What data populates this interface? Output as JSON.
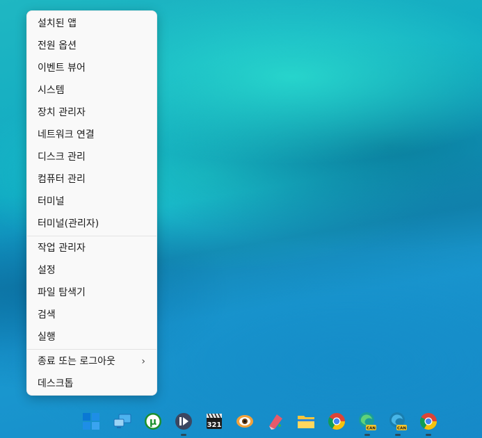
{
  "menu": {
    "items": [
      {
        "label": "설치된 앱"
      },
      {
        "label": "전원 옵션"
      },
      {
        "label": "이벤트 뷰어"
      },
      {
        "label": "시스템"
      },
      {
        "label": "장치 관리자"
      },
      {
        "label": "네트워크 연결"
      },
      {
        "label": "디스크 관리"
      },
      {
        "label": "컴퓨터 관리"
      },
      {
        "label": "터미널"
      },
      {
        "label": "터미널(관리자)"
      },
      {
        "label": "작업 관리자"
      },
      {
        "label": "설정"
      },
      {
        "label": "파일 탐색기"
      },
      {
        "label": "검색"
      },
      {
        "label": "실행"
      },
      {
        "label": "종료 또는 로그아웃",
        "chevron": "›"
      },
      {
        "label": "데스크톱"
      }
    ]
  },
  "taskbar": {
    "icons": [
      {
        "name": "windows-start-icon"
      },
      {
        "name": "remote-desktop-icon"
      },
      {
        "name": "utorrent-icon"
      },
      {
        "name": "media-player-icon"
      },
      {
        "name": "media-player-classic-icon"
      },
      {
        "name": "eye-app-icon"
      },
      {
        "name": "drawing-app-icon"
      },
      {
        "name": "file-explorer-icon"
      },
      {
        "name": "chrome-icon"
      },
      {
        "name": "edge-canary-icon"
      },
      {
        "name": "edge-canary-icon-2"
      },
      {
        "name": "chrome-icon-2"
      }
    ],
    "can_badge": "CAN",
    "utorrent_glyph": "µ",
    "mpc_digits": "321"
  }
}
